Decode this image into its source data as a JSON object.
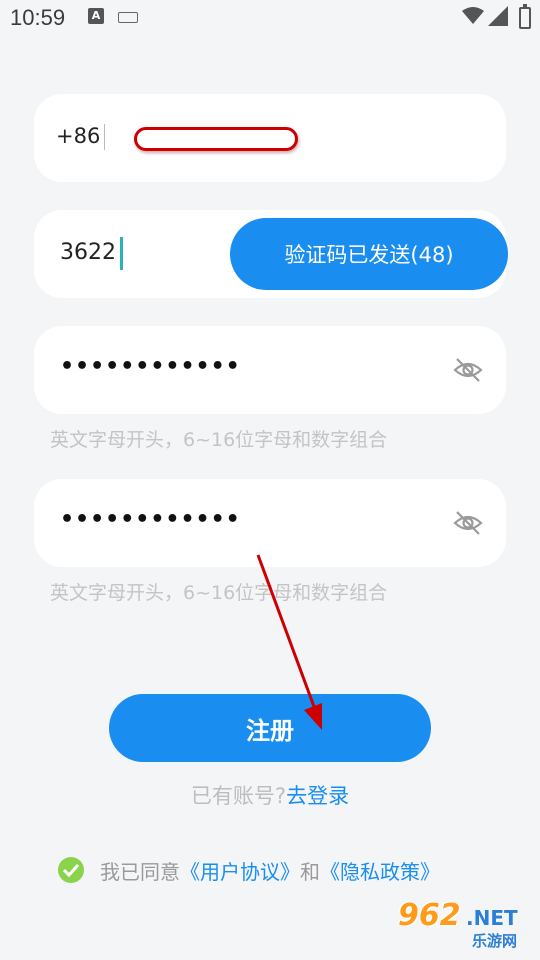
{
  "status_bar": {
    "time": "10:59",
    "notification_icons": [
      "text-a-icon",
      "keyboard-icon"
    ],
    "system_icons": [
      "wifi-icon",
      "signal-icon",
      "battery-charging-icon"
    ]
  },
  "form": {
    "phone": {
      "country_code": "+86",
      "value_redacted": true
    },
    "verification_code": {
      "value": "3622",
      "send_button_label": "验证码已发送(48)"
    },
    "password": {
      "masked_value": "••••••••••••",
      "hint": "英文字母开头，6~16位字母和数字组合",
      "toggle_icon": "eye-off-icon"
    },
    "confirm_password": {
      "masked_value": "••••••••••••",
      "hint": "英文字母开头，6~16位字母和数字组合",
      "toggle_icon": "eye-off-icon"
    },
    "register_button_label": "注册",
    "login_prompt": "已有账号?",
    "login_link": "去登录"
  },
  "agreement": {
    "checked": true,
    "prefix": "我已同意",
    "user_agreement": "《用户协议》",
    "conjunction": "和",
    "privacy_policy": "《隐私政策》"
  },
  "watermark": {
    "brand_number": "962",
    "brand_suffix": ".NET",
    "subtitle": "乐游网"
  },
  "colors": {
    "primary": "#1a8ef0",
    "background": "#f4f5f7",
    "hint": "#c4c4c4",
    "check": "#8bd34b",
    "annotation": "#cc0000"
  }
}
